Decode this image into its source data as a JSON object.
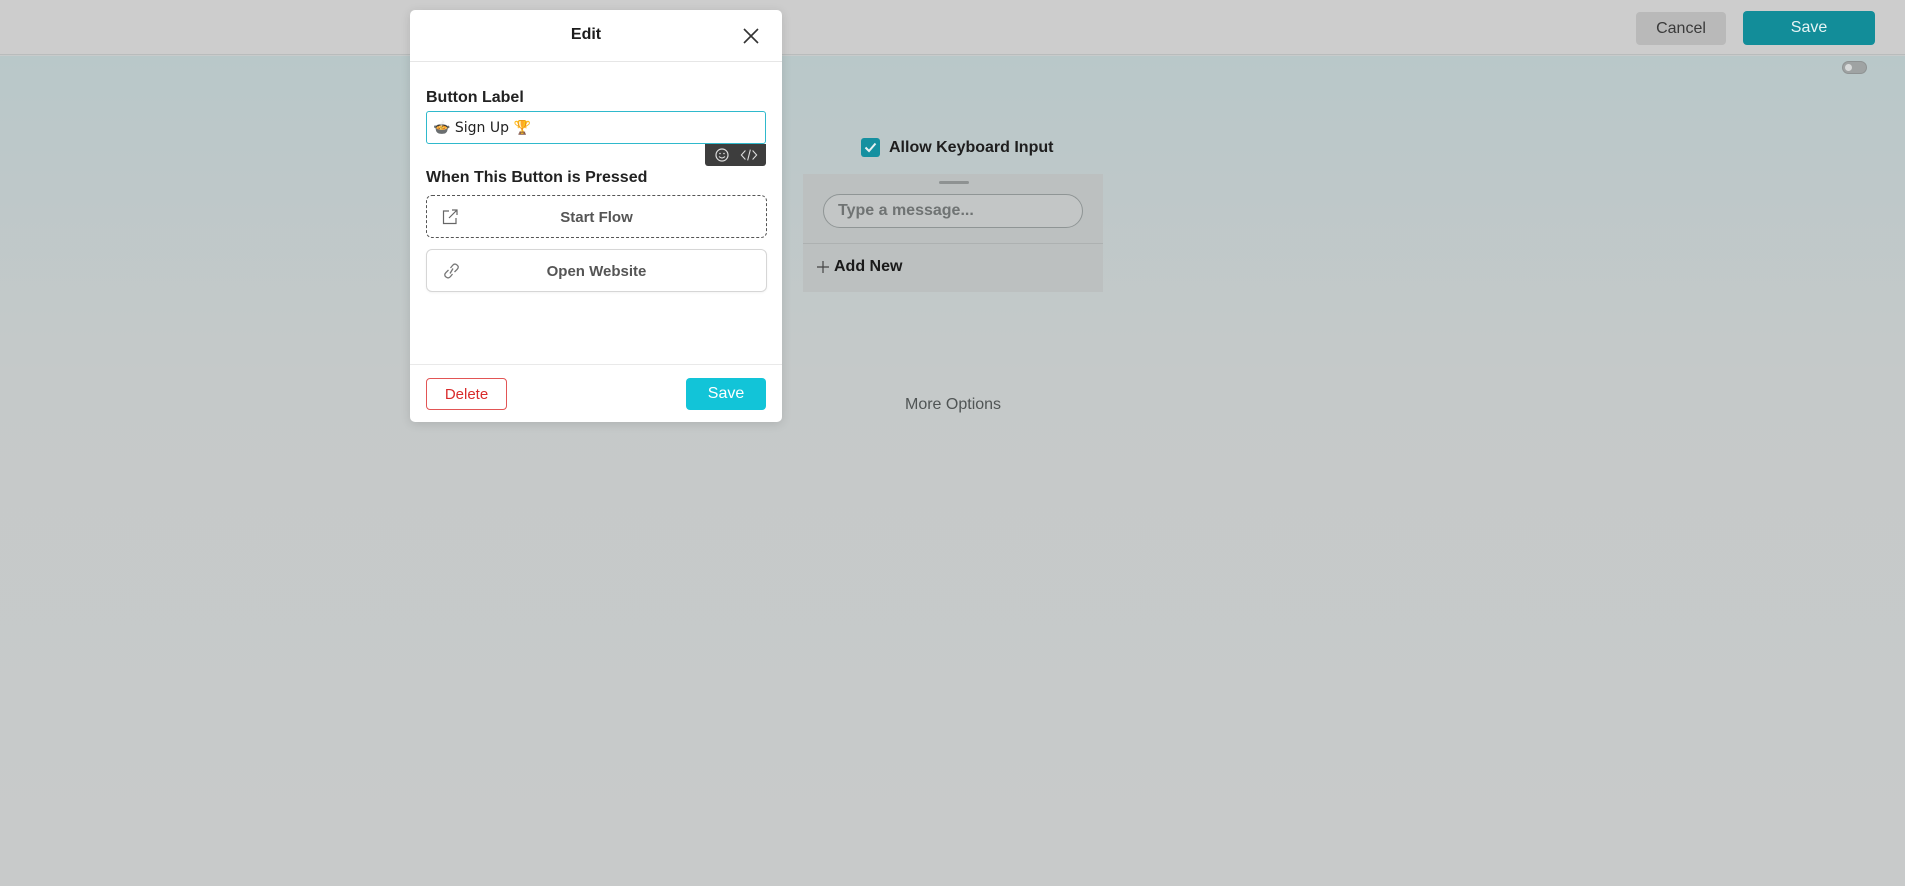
{
  "topbar": {
    "cancel_label": "Cancel",
    "save_label": "Save"
  },
  "preview": {
    "allow_keyboard_label": "Allow Keyboard Input",
    "allow_keyboard_checked": true,
    "message_placeholder": "Type a message...",
    "add_new_label": "Add New",
    "more_options_label": "More Options"
  },
  "modal": {
    "title": "Edit",
    "button_label_heading": "Button Label",
    "button_label_value": "🍲 Sign Up 🏆",
    "when_pressed_heading": "When This Button is Pressed",
    "actions": [
      {
        "label": "Start Flow",
        "icon": "external-link-icon"
      },
      {
        "label": "Open Website",
        "icon": "link-icon"
      }
    ],
    "delete_label": "Delete",
    "save_label": "Save"
  },
  "colors": {
    "accent": "#12c4d8",
    "top_save": "#128d99",
    "delete": "#d92b2b",
    "input_focus": "#2fb9cc"
  }
}
